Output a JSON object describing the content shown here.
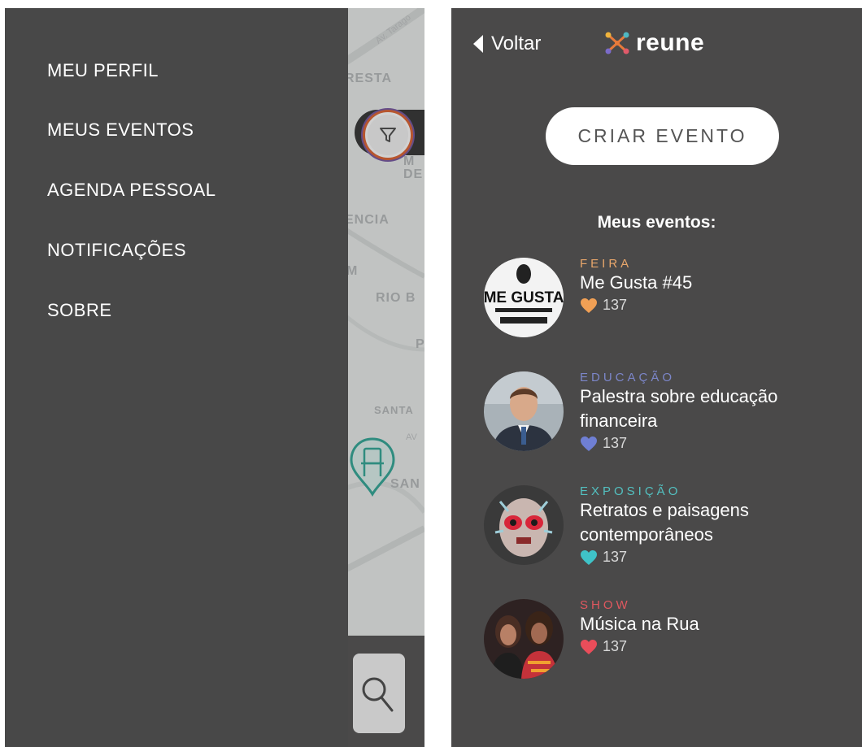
{
  "side_menu": {
    "items": [
      {
        "label": "MEU PERFIL"
      },
      {
        "label": "MEUS EVENTOS"
      },
      {
        "label": "AGENDA PESSOAL"
      },
      {
        "label": "NOTIFICAÇÕES"
      },
      {
        "label": "SOBRE"
      }
    ]
  },
  "map": {
    "labels": [
      "RESTA",
      "M",
      "DE",
      "ENCIA",
      "M",
      "RIO B",
      "P",
      "SANTA",
      "SAN"
    ],
    "street_labels": [
      "Av. Tarago",
      "AV"
    ]
  },
  "events_screen": {
    "back_label": "Voltar",
    "logo_text": "reune",
    "create_button": "CRIAR EVENTO",
    "section_title": "Meus eventos:",
    "events": [
      {
        "category": "FEIRA",
        "category_color": "#e8a66b",
        "title": "Me Gusta #45",
        "likes": "137",
        "heart_color": "#f1a055",
        "avatar_text": "ME GUSTA"
      },
      {
        "category": "EDUCAÇÃO",
        "category_color": "#7c86c9",
        "title": "Palestra sobre educação financeira",
        "likes": "137",
        "heart_color": "#6f7fd4"
      },
      {
        "category": "EXPOSIÇÃO",
        "category_color": "#53c0c0",
        "title": "Retratos e paisagens contemporâneos",
        "likes": "137",
        "heart_color": "#3fc3c8"
      },
      {
        "category": "SHOW",
        "category_color": "#e0585f",
        "title": "Música na Rua",
        "likes": "137",
        "heart_color": "#ea4d5a"
      }
    ]
  }
}
